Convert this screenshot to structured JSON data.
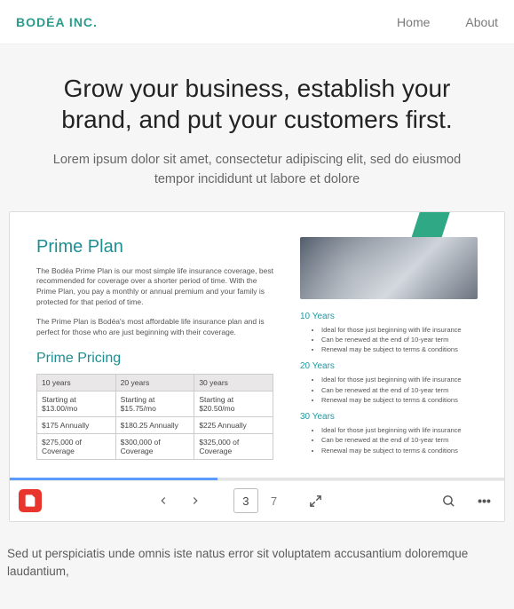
{
  "brand": "BODÉA INC.",
  "nav": {
    "home": "Home",
    "about": "About"
  },
  "hero": {
    "title": "Grow your business, establish your brand, and put your customers first.",
    "subtitle": "Lorem ipsum dolor sit amet, consectetur adipiscing elit, sed do eiusmod tempor incididunt ut labore et dolore"
  },
  "doc": {
    "plan_heading": "Prime Plan",
    "plan_p1": "The Bodéa Prime Plan is our most simple life insurance coverage, best recommended for coverage over a shorter period of time. With the Prime Plan, you pay a monthly or annual premium and your family is protected for that period of time.",
    "plan_p2": "The Prime Plan is Bodéa's most affordable life insurance plan and is perfect for those who are just beginning with their coverage.",
    "pricing_heading": "Prime Pricing",
    "table": {
      "headers": [
        "10 years",
        "20 years",
        "30 years"
      ],
      "rows": [
        [
          "Starting at $13.00/mo",
          "Starting at $15.75/mo",
          "Starting at $20.50/mo"
        ],
        [
          "$175 Annually",
          "$180.25 Annually",
          "$225 Annually"
        ],
        [
          "$275,000 of Coverage",
          "$300,000 of Coverage",
          "$325,000 of Coverage"
        ]
      ]
    },
    "sections": [
      {
        "title": "10 Years",
        "bullets": [
          "Ideal for those just beginning with life insurance",
          "Can be renewed at the end of 10-year term",
          "Renewal may be subject to terms & conditions"
        ]
      },
      {
        "title": "20 Years",
        "bullets": [
          "Ideal for those just beginning with life insurance",
          "Can be renewed at the end of 10-year term",
          "Renewal may be subject to terms & conditions"
        ]
      },
      {
        "title": "30 Years",
        "bullets": [
          "Ideal for those just beginning with life insurance",
          "Can be renewed at the end of 10-year term",
          "Renewal may be subject to terms & conditions"
        ]
      }
    ]
  },
  "viewer": {
    "current_page": "3",
    "total_pages": "7"
  },
  "footer": "Sed ut perspiciatis unde omnis iste natus error sit voluptatem accusantium doloremque laudantium,"
}
